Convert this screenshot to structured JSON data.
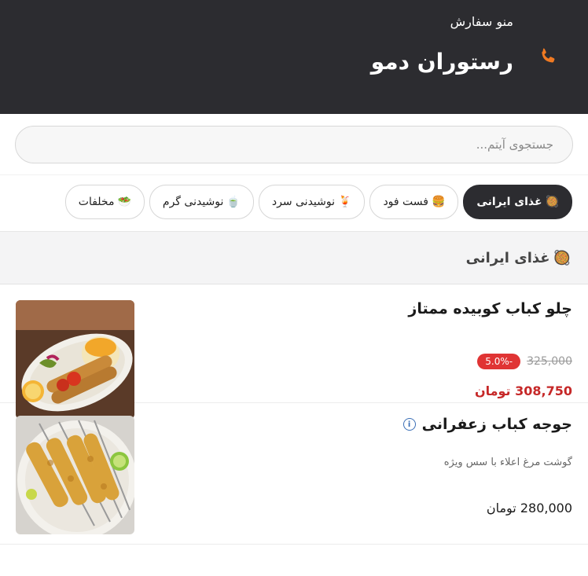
{
  "header": {
    "subtitle": "منو سفارش",
    "title": "رستوران دمو",
    "phone_icon": "phone-icon",
    "accent": "#f07a22",
    "bg": "#2c2c30"
  },
  "search": {
    "placeholder": "جستجوی آیتم..."
  },
  "categories": [
    {
      "emoji": "🥘",
      "label": "غذای ایرانی",
      "active": true
    },
    {
      "emoji": "🍔",
      "label": "فست فود"
    },
    {
      "emoji": "🍹",
      "label": "نوشیدنی سرد"
    },
    {
      "emoji": "🍵",
      "label": "نوشیدنی گرم"
    },
    {
      "emoji": "🥗",
      "label": "مخلفات"
    }
  ],
  "section": {
    "emoji": "🥘",
    "title": "غذای ایرانی"
  },
  "items": [
    {
      "name": "چلو کباب کوبیده ممتاز",
      "old_price": "325,000",
      "discount": "-5.0%",
      "final_price": "308,750 تومان"
    },
    {
      "name": "جوجه کباب زعفرانی",
      "info_icon": "info-icon",
      "description": "گوشت مرغ اعلاء با سس ویژه",
      "price": "280,000 تومان"
    }
  ]
}
